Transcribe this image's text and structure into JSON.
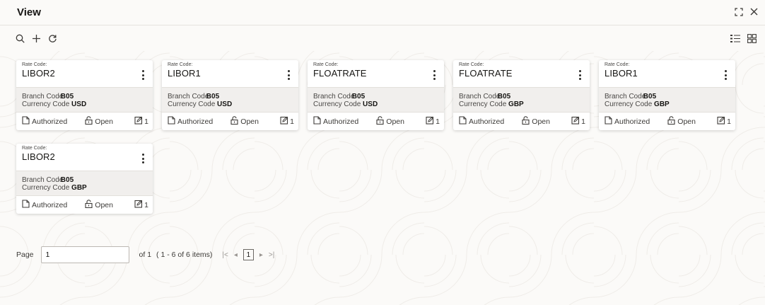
{
  "window": {
    "title": "View"
  },
  "toolbar": {
    "icons": [
      "search-icon",
      "add-icon",
      "refresh-icon"
    ],
    "view_icons": [
      "list-view-icon",
      "tile-view-icon"
    ]
  },
  "card_labels": {
    "key_label": "Rate Code:",
    "branch_label": "Branch Code",
    "currency_label": "Currency Code",
    "authorized": "Authorized",
    "open": "Open",
    "mod": "1"
  },
  "cards": [
    {
      "rate_code": "LIBOR2",
      "branch_code": "B05",
      "currency_code": "USD"
    },
    {
      "rate_code": "LIBOR1",
      "branch_code": "B05",
      "currency_code": "USD"
    },
    {
      "rate_code": "FLOATRATE",
      "branch_code": "B05",
      "currency_code": "USD"
    },
    {
      "rate_code": "FLOATRATE",
      "branch_code": "B05",
      "currency_code": "GBP"
    },
    {
      "rate_code": "LIBOR1",
      "branch_code": "B05",
      "currency_code": "GBP"
    },
    {
      "rate_code": "LIBOR2",
      "branch_code": "B05",
      "currency_code": "GBP"
    }
  ],
  "pagination": {
    "page_label": "Page",
    "page_value": "1",
    "of_text": "of 1",
    "items_text": "( 1 - 6 of 6 items)",
    "current_page": "1",
    "first_symbol": "|<",
    "prev_symbol": "◂",
    "next_symbol": "▸",
    "last_symbol": ">|"
  },
  "colors": {
    "background": "#fbfaf8",
    "card": "#ffffff",
    "card_body": "#f1efed",
    "text": "#161513"
  }
}
